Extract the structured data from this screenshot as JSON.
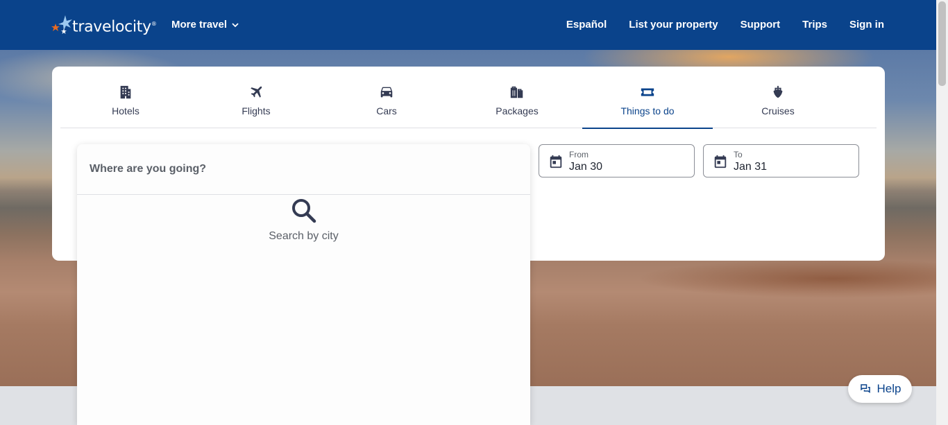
{
  "header": {
    "logo_text": "travelocity",
    "logo_tm": "®",
    "more_travel": "More travel",
    "nav": [
      "Español",
      "List your property",
      "Support",
      "Trips",
      "Sign in"
    ]
  },
  "tabs": [
    {
      "label": "Hotels",
      "icon": "hotel-icon",
      "active": false
    },
    {
      "label": "Flights",
      "icon": "plane-icon",
      "active": false
    },
    {
      "label": "Cars",
      "icon": "car-icon",
      "active": false
    },
    {
      "label": "Packages",
      "icon": "suitcase-icon",
      "active": false
    },
    {
      "label": "Things to do",
      "icon": "ticket-icon",
      "active": true
    },
    {
      "label": "Cruises",
      "icon": "cruise-icon",
      "active": false
    }
  ],
  "search": {
    "placeholder": "Where are you going?",
    "hint": "Search by city"
  },
  "dates": {
    "from_label": "From",
    "from_value": "Jan 30",
    "to_label": "To",
    "to_value": "Jan 31"
  },
  "help": {
    "label": "Help"
  },
  "colors": {
    "brand": "#0a438b",
    "text": "#343b53"
  }
}
